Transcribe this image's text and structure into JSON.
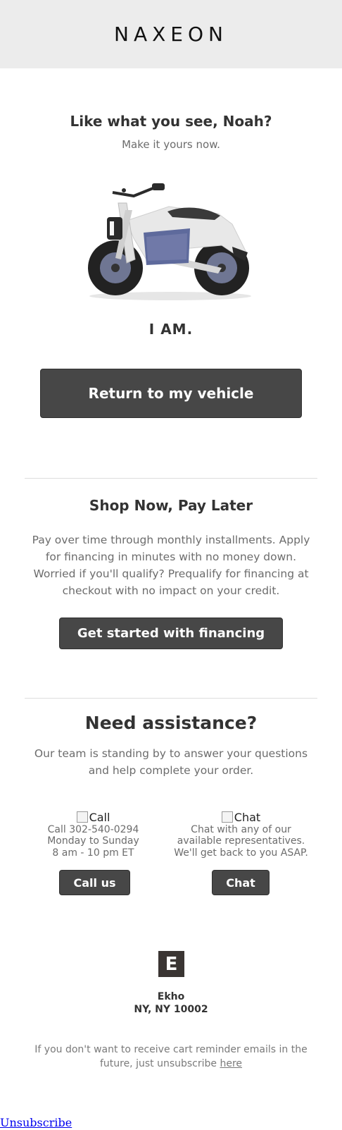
{
  "header": {
    "logo": "NAXEON"
  },
  "hero": {
    "title": "Like what you see, Noah?",
    "subtitle": "Make it yours now.",
    "product_name": "I AM.",
    "cta_label": "Return to my vehicle"
  },
  "financing": {
    "title": "Shop Now, Pay Later",
    "body": "Pay over time through monthly installments. Apply for financing in minutes with no money down. Worried if you'll qualify? Prequalify for financing at checkout with no impact on your credit.",
    "cta_label": "Get started with financing"
  },
  "assistance": {
    "title": "Need assistance?",
    "body": "Our team is standing by to answer your questions and help complete your order.",
    "call": {
      "alt": "Call",
      "line1": "Call 302-540-0294",
      "line2": "Monday to Sunday",
      "line3": "8 am - 10 pm ET",
      "button": "Call us"
    },
    "chat": {
      "alt": "Chat",
      "line1": "Chat with any of our",
      "line2": "available representatives.",
      "line3": "We'll get back to you ASAP.",
      "button": "Chat"
    }
  },
  "footer": {
    "brand_letter": "E",
    "company": "Ekho",
    "address": "NY, NY 10002",
    "unsub_note": "If you don't want to receive cart reminder emails in the future, just unsubscribe",
    "unsub_here": "here",
    "unsubscribe": "Unsubscribe"
  },
  "colors": {
    "header_bg": "#ececec",
    "button_bg": "#474747",
    "text_muted": "#6c6c6c",
    "divider": "#dddddd"
  }
}
